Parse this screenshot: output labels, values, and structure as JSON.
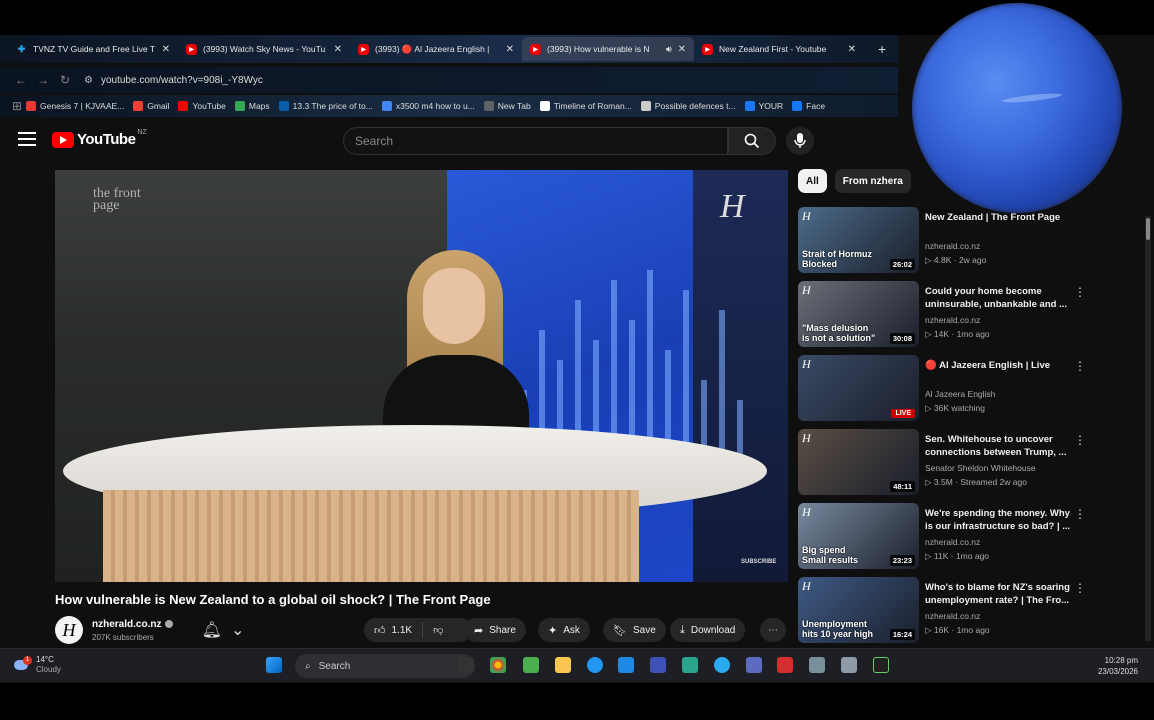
{
  "browser": {
    "tabs": [
      {
        "title": "TVNZ TV Guide and Free Live T",
        "favicon": "tvnz-icon",
        "active": false
      },
      {
        "title": "(3993) Watch Sky News - YouTu",
        "favicon": "youtube-icon",
        "active": false
      },
      {
        "title": "(3993) 🔴 Al Jazeera English |",
        "favicon": "youtube-icon",
        "active": false
      },
      {
        "title": "(3993) How vulnerable is N",
        "favicon": "youtube-icon",
        "active": true
      },
      {
        "title": "New Zealand First - Youtube",
        "favicon": "youtube-icon",
        "active": false
      }
    ],
    "new_tab": "+",
    "url": "youtube.com/watch?v=908i_-Y8Wyc",
    "bookmarks": [
      {
        "label": "Genesis 7 | KJVAAE...",
        "color": "#e53935"
      },
      {
        "label": "Gmail",
        "color": "#ea4335"
      },
      {
        "label": "YouTube",
        "color": "#ff0000"
      },
      {
        "label": "Maps",
        "color": "#34a853"
      },
      {
        "label": "13.3 The price of to...",
        "color": "#0b5cab"
      },
      {
        "label": "x3500 m4 how to u...",
        "color": "#4285f4"
      },
      {
        "label": "New Tab",
        "color": "#5f6368"
      },
      {
        "label": "Timeline of Roman...",
        "color": "#ffffff"
      },
      {
        "label": "Possible defences t...",
        "color": "#cccccc"
      },
      {
        "label": "YOUR",
        "color": "#1877f2"
      },
      {
        "label": "Face",
        "color": "#1877f2"
      }
    ]
  },
  "youtube": {
    "logo": "YouTube",
    "region": "NZ",
    "search_placeholder": "Search",
    "video": {
      "title": "How vulnerable is New Zealand to a global oil shock? | The Front Page",
      "overlay_brand": "the front page",
      "subscribe_watermark": "SUBSCRIBE",
      "channel": "nzherald.co.nz",
      "subscribers": "207K subscribers",
      "likes": "1.1K",
      "share": "Share",
      "ask": "Ask",
      "save": "Save",
      "download": "Download"
    },
    "chips": [
      {
        "label": "All",
        "selected": true
      },
      {
        "label": "From nzhera",
        "selected": false
      }
    ],
    "recommendations": [
      {
        "title": "New Zealand | The Front Page",
        "channel": "nzherald.co.nz",
        "meta": "▷ 4.8K · 2w ago",
        "duration": "26:02",
        "caption": "Strait of Hormuz\nBlocked",
        "live": false,
        "thumb_color": "#4d6c8a"
      },
      {
        "title": "Could your home become uninsurable, unbankable and ...",
        "channel": "nzherald.co.nz",
        "meta": "▷ 14K · 1mo ago",
        "duration": "30:08",
        "caption": "\"Mass delusion\nis not a solution\"",
        "live": false,
        "thumb_color": "#6b6f78"
      },
      {
        "title": "🔴 Al Jazeera English | Live",
        "channel": "Al Jazeera English",
        "meta": "▷ 36K watching",
        "duration": "LIVE",
        "caption": "",
        "live": true,
        "thumb_color": "#3a4a66"
      },
      {
        "title": "Sen. Whitehouse to uncover connections between Trump, ...",
        "channel": "Senator Sheldon Whitehouse",
        "meta": "▷ 3.5M · Streamed 2w ago",
        "duration": "48:11",
        "caption": "",
        "live": false,
        "thumb_color": "#5a4e44"
      },
      {
        "title": "We're spending the money. Why is our infrastructure so bad? | ...",
        "channel": "nzherald.co.nz",
        "meta": "▷ 11K · 1mo ago",
        "duration": "23:23",
        "caption": "Big spend\nSmall results",
        "live": false,
        "thumb_color": "#7a8aa0"
      },
      {
        "title": "Who's to blame for NZ's soaring unemployment rate? | The Fro...",
        "channel": "nzherald.co.nz",
        "meta": "▷ 16K · 1mo ago",
        "duration": "16:24",
        "caption": "Unemployment\nhits 10 year high",
        "live": false,
        "thumb_color": "#3f5a85"
      }
    ]
  },
  "taskbar": {
    "weather_temp": "14°C",
    "weather_text": "Cloudy",
    "weather_badge": "1",
    "search_placeholder": "Search",
    "time": "10:28 pm",
    "date": "23/03/2026"
  }
}
